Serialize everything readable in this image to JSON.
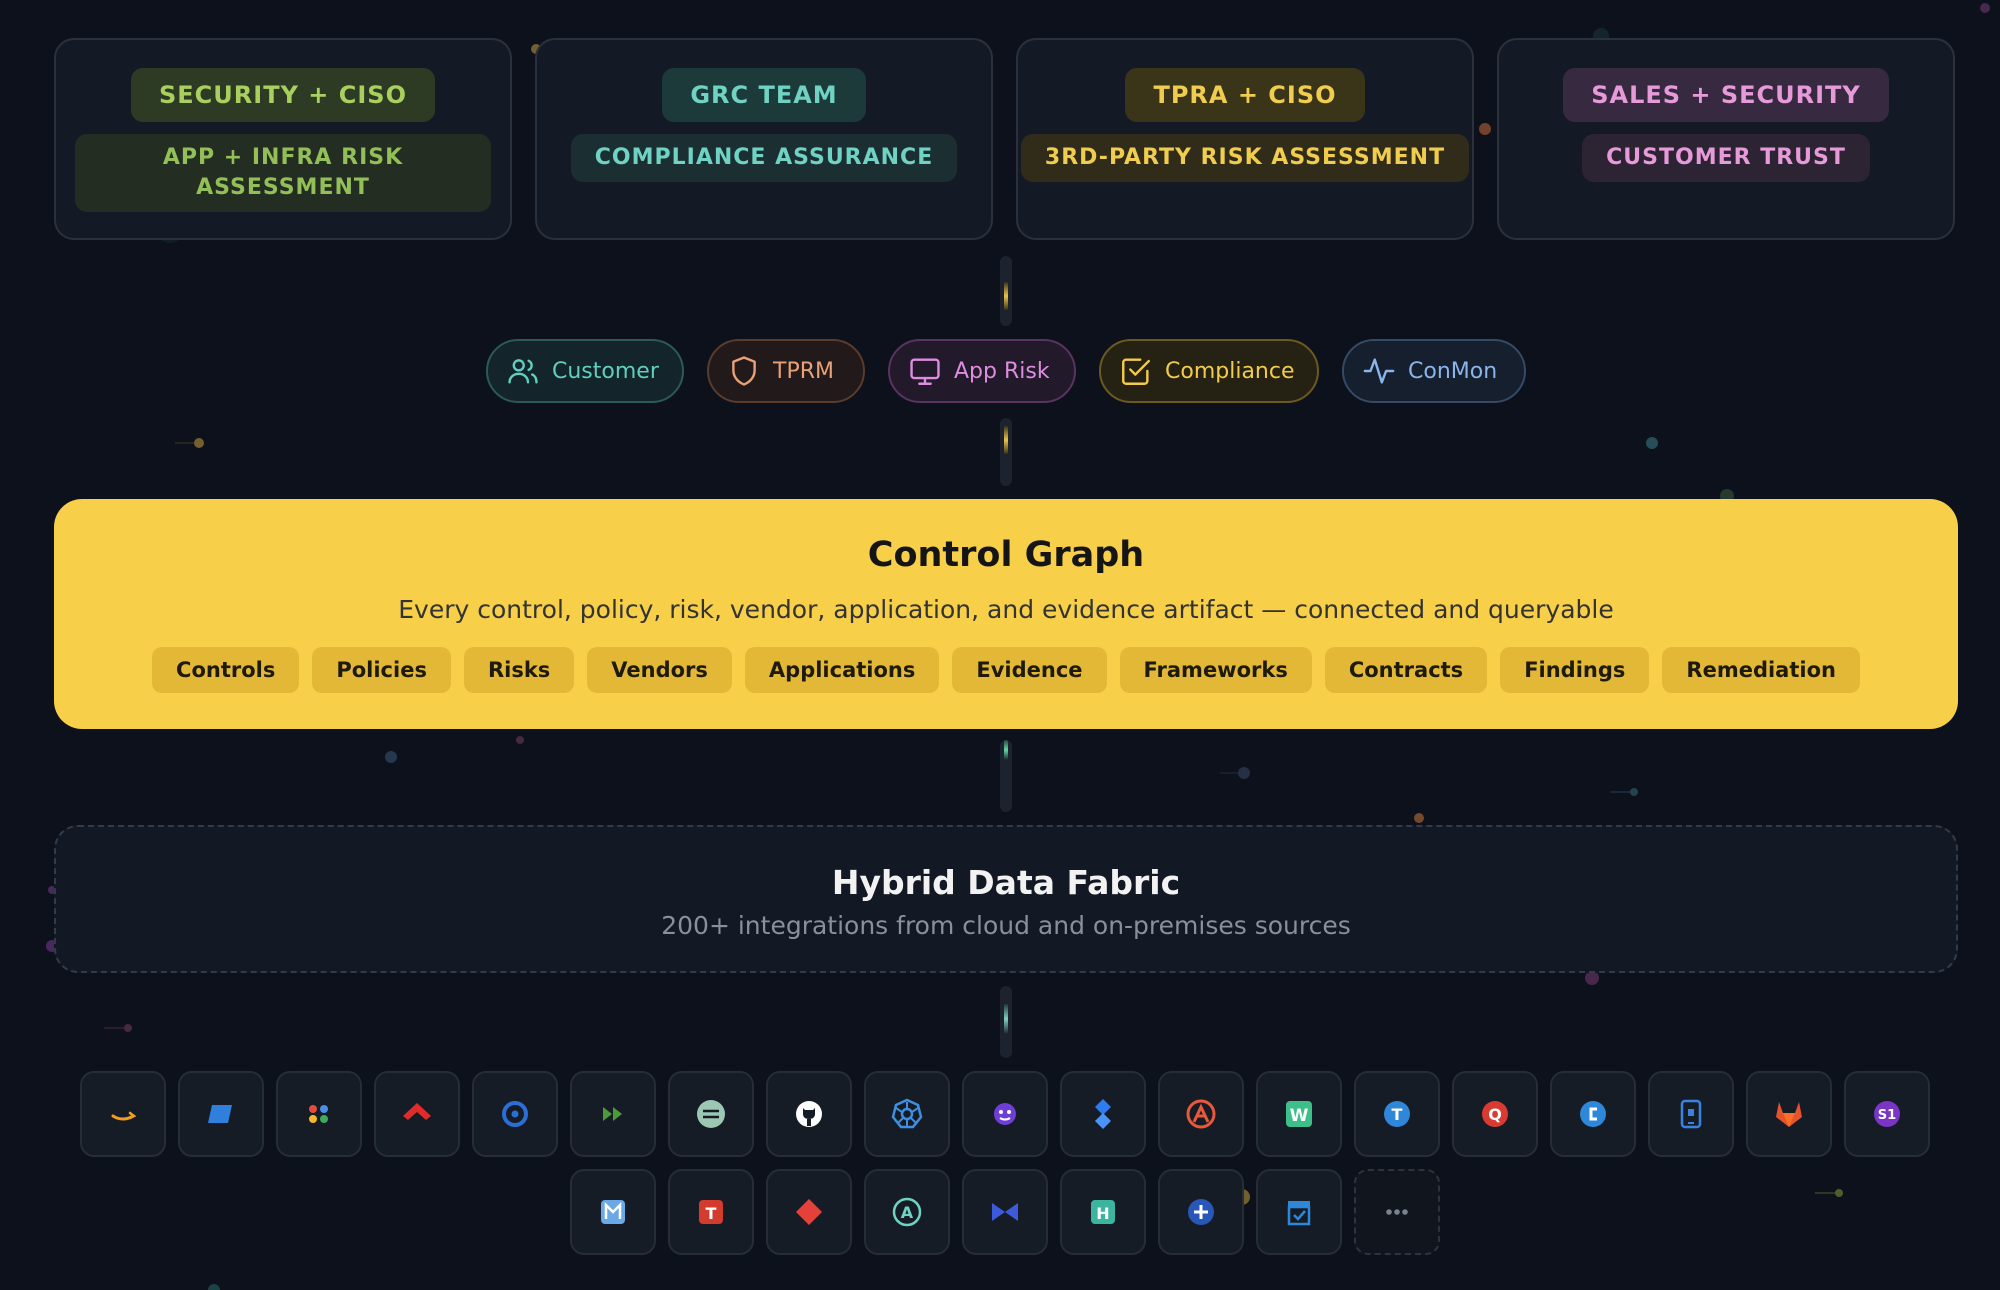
{
  "teams": [
    {
      "owner": "SECURITY + CISO",
      "focus": "APP + INFRA RISK ASSESSMENT",
      "pill_bg": "#2e3b24",
      "pill_fg": "#a9cf5e",
      "sub_bg": "#232d21",
      "sub_fg": "#93bf58"
    },
    {
      "owner": "GRC TEAM",
      "focus": "COMPLIANCE ASSURANCE",
      "pill_bg": "#1d3a3b",
      "pill_fg": "#6fd2c3",
      "sub_bg": "#1b2f33",
      "sub_fg": "#6fd2c3"
    },
    {
      "owner": "TPRA + CISO",
      "focus": "3RD-PARTY RISK ASSESSMENT",
      "pill_bg": "#3a3418",
      "pill_fg": "#f0cd4e",
      "sub_bg": "#302c19",
      "sub_fg": "#f0cd4e"
    },
    {
      "owner": "SALES + SECURITY",
      "focus": "CUSTOMER TRUST",
      "pill_bg": "#372a40",
      "pill_fg": "#e79ad9",
      "sub_bg": "#2c2333",
      "sub_fg": "#e79ad9"
    }
  ],
  "use_cases": [
    {
      "label": "Customer",
      "icon": "users-icon",
      "color": "#5fcfbe",
      "border": "#2b5a57",
      "bg": "#13242a"
    },
    {
      "label": "TPRM",
      "icon": "shield-icon",
      "color": "#e8a077",
      "border": "#5a3b2c",
      "bg": "#221a1a"
    },
    {
      "label": "App Risk",
      "icon": "monitor-icon",
      "color": "#dd8ce0",
      "border": "#5a3361",
      "bg": "#221a2a"
    },
    {
      "label": "Compliance",
      "icon": "check-square-icon",
      "color": "#f3cb4a",
      "border": "#6b5a20",
      "bg": "#252214"
    },
    {
      "label": "ConMon",
      "icon": "activity-icon",
      "color": "#8ab4ec",
      "border": "#354a66",
      "bg": "#161f2d"
    }
  ],
  "control_graph": {
    "title": "Control Graph",
    "subtitle": "Every control, policy, risk, vendor, application, and evidence artifact — connected and queryable",
    "tags": [
      "Controls",
      "Policies",
      "Risks",
      "Vendors",
      "Applications",
      "Evidence",
      "Frameworks",
      "Contracts",
      "Findings",
      "Remediation"
    ]
  },
  "data_fabric": {
    "title": "Hybrid Data Fabric",
    "subtitle": "200+ integrations from cloud and on-premises sources"
  },
  "integrations": [
    {
      "icon": "aws-icon",
      "color": "#f39c1f"
    },
    {
      "icon": "azure-icon",
      "color": "#2f7fdc"
    },
    {
      "icon": "google-cloud-icon",
      "color": "#e34b3d"
    },
    {
      "icon": "crowdstrike-icon",
      "color": "#e02b2b"
    },
    {
      "icon": "okta-icon",
      "color": "#2b6fd6"
    },
    {
      "icon": "fastforward-icon",
      "color": "#4e9a3a"
    },
    {
      "icon": "equals-circle-icon",
      "color": "#9cc7b3"
    },
    {
      "icon": "github-icon",
      "color": "#ffffff"
    },
    {
      "icon": "kubernetes-icon",
      "color": "#3f8fe0"
    },
    {
      "icon": "mascot-icon",
      "color": "#6e3ed6"
    },
    {
      "icon": "jira-icon",
      "color": "#2c7bf0"
    },
    {
      "icon": "apex-icon",
      "color": "#e8583a"
    },
    {
      "icon": "w-icon",
      "color": "#3cbf88"
    },
    {
      "icon": "t-circle-icon",
      "color": "#2e87d8"
    },
    {
      "icon": "q-icon",
      "color": "#d93a32"
    },
    {
      "icon": "c-circle-icon",
      "color": "#2e87d8"
    },
    {
      "icon": "tablet-icon",
      "color": "#3b82e0"
    },
    {
      "icon": "gitlab-icon",
      "color": "#e5532d"
    },
    {
      "icon": "s1-icon",
      "color": "#7a35c7"
    },
    {
      "icon": "m-square-icon",
      "color": "#6aa8e8"
    },
    {
      "icon": "t-square-icon",
      "color": "#d33b2c"
    },
    {
      "icon": "diamond-icon",
      "color": "#e5403a"
    },
    {
      "icon": "a-circle-icon",
      "color": "#6fd2c3"
    },
    {
      "icon": "bowtie-icon",
      "color": "#3b5bdc"
    },
    {
      "icon": "h-square-icon",
      "color": "#3bb5a0"
    },
    {
      "icon": "plus-circle-icon",
      "color": "#2857b8"
    },
    {
      "icon": "calendar-check-icon",
      "color": "#2e87d8"
    },
    {
      "icon": "more-icon",
      "color": "#7a828e"
    }
  ]
}
